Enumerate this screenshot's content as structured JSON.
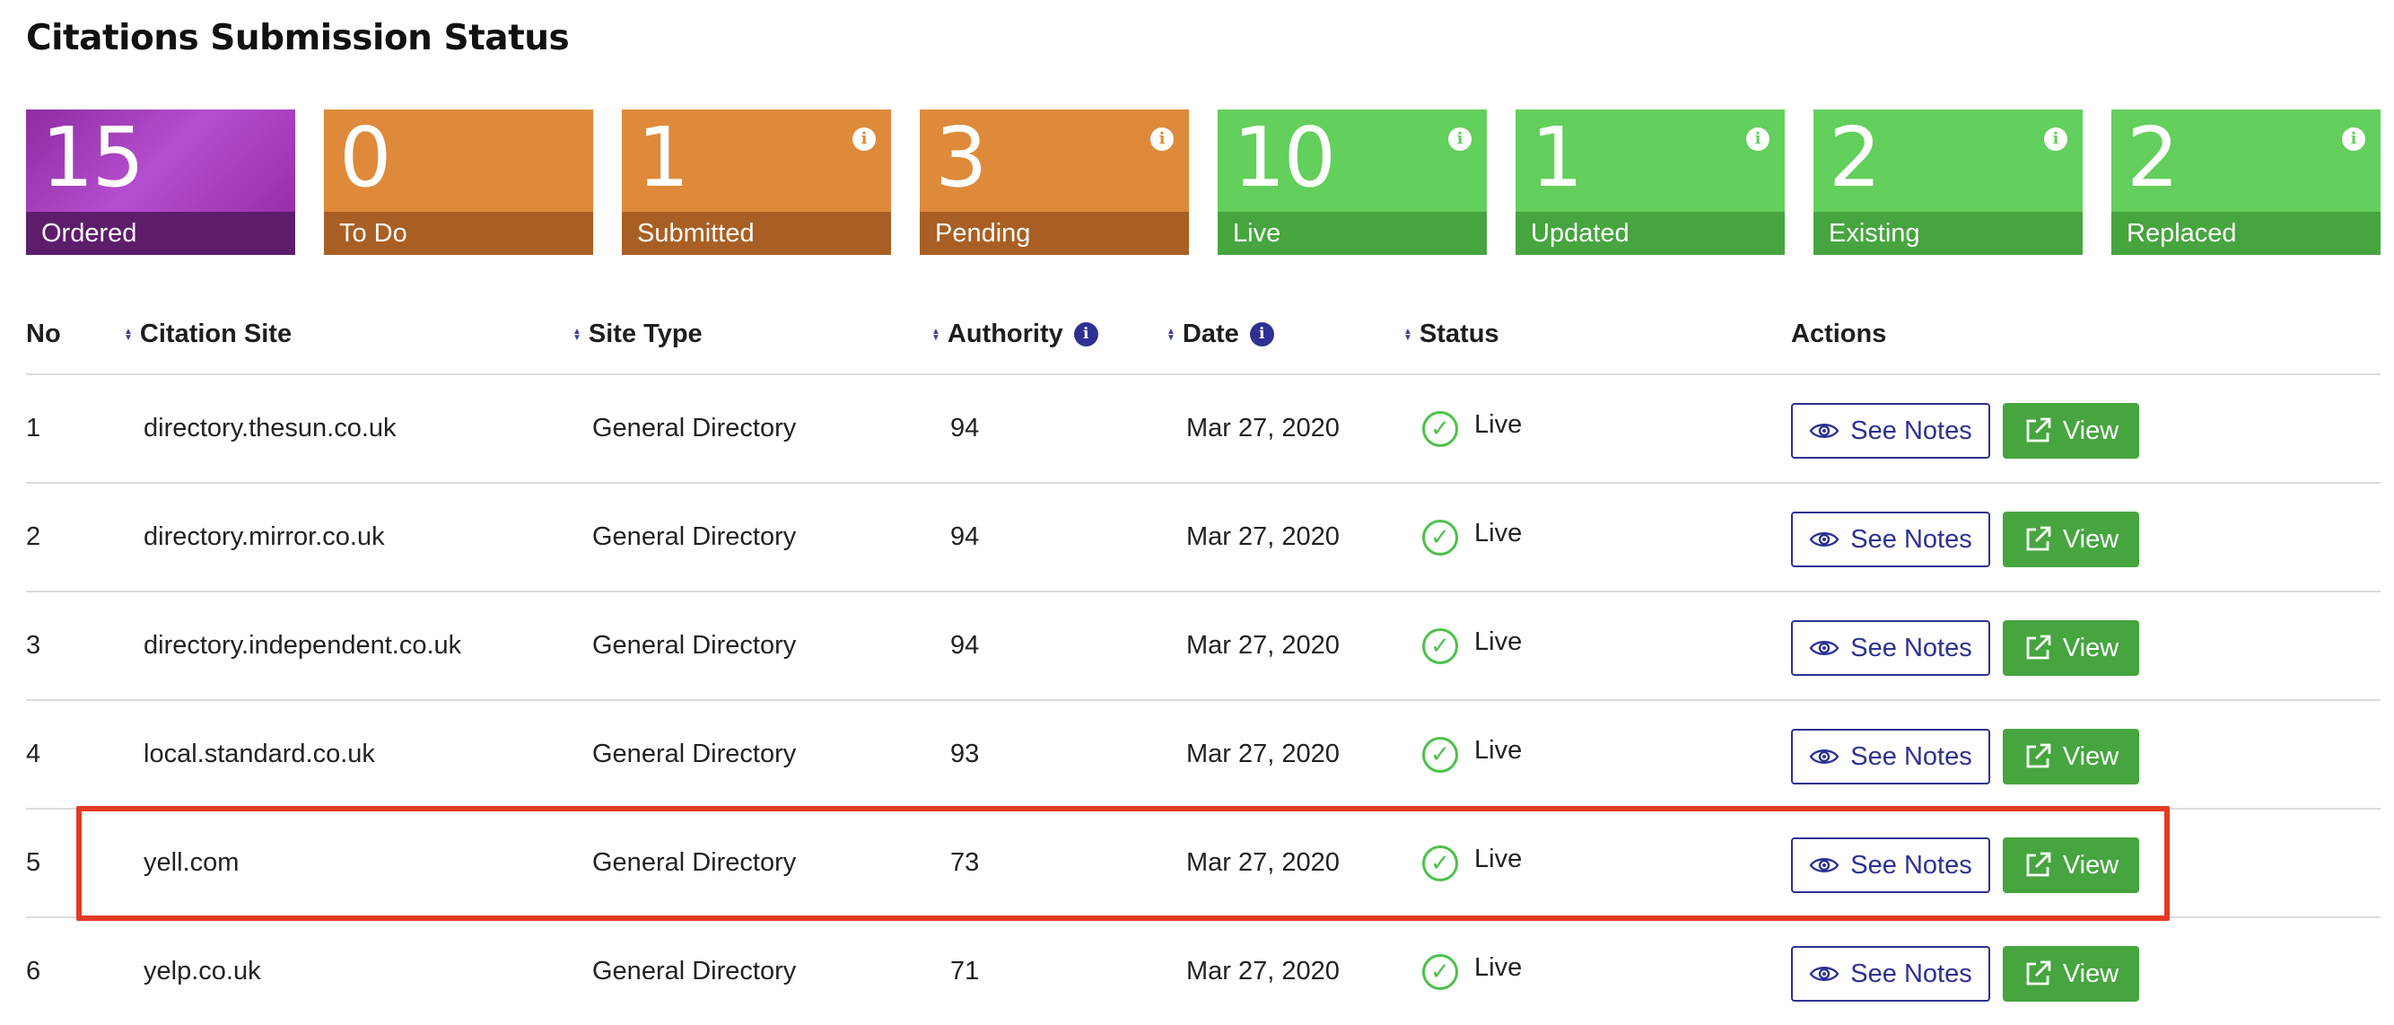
{
  "page": {
    "title": "Citations Submission Status"
  },
  "stats": [
    {
      "value": "15",
      "label": "Ordered",
      "color": "purple",
      "info": false
    },
    {
      "value": "0",
      "label": "To Do",
      "color": "orange",
      "info": false
    },
    {
      "value": "1",
      "label": "Submitted",
      "color": "orange",
      "info": true
    },
    {
      "value": "3",
      "label": "Pending",
      "color": "orange",
      "info": true
    },
    {
      "value": "10",
      "label": "Live",
      "color": "green",
      "info": true
    },
    {
      "value": "1",
      "label": "Updated",
      "color": "green",
      "info": true
    },
    {
      "value": "2",
      "label": "Existing",
      "color": "green",
      "info": true
    },
    {
      "value": "2",
      "label": "Replaced",
      "color": "green",
      "info": true
    }
  ],
  "colors": {
    "purple": "#a63fc0",
    "orange": "#de8a3a",
    "green": "#63cf5c",
    "navy": "#2e3192",
    "highlight": "#e33b24"
  },
  "table": {
    "headers": {
      "no": "No",
      "site": "Citation Site",
      "type": "Site Type",
      "authority": "Authority",
      "date": "Date",
      "status": "Status",
      "actions": "Actions"
    },
    "buttons": {
      "notes": "See Notes",
      "view": "View"
    },
    "rows": [
      {
        "no": "1",
        "site": "directory.thesun.co.uk",
        "type": "General Directory",
        "authority": "94",
        "date": "Mar 27, 2020",
        "status": "Live"
      },
      {
        "no": "2",
        "site": "directory.mirror.co.uk",
        "type": "General Directory",
        "authority": "94",
        "date": "Mar 27, 2020",
        "status": "Live"
      },
      {
        "no": "3",
        "site": "directory.independent.co.uk",
        "type": "General Directory",
        "authority": "94",
        "date": "Mar 27, 2020",
        "status": "Live"
      },
      {
        "no": "4",
        "site": "local.standard.co.uk",
        "type": "General Directory",
        "authority": "93",
        "date": "Mar 27, 2020",
        "status": "Live"
      },
      {
        "no": "5",
        "site": "yell.com",
        "type": "General Directory",
        "authority": "73",
        "date": "Mar 27, 2020",
        "status": "Live"
      },
      {
        "no": "6",
        "site": "yelp.co.uk",
        "type": "General Directory",
        "authority": "71",
        "date": "Mar 27, 2020",
        "status": "Live"
      }
    ]
  }
}
